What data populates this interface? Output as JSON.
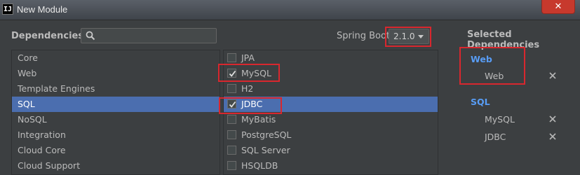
{
  "window": {
    "icon_text": "IJ",
    "title": "New Module",
    "close_glyph": "✕"
  },
  "header": {
    "dependencies_label": "Dependencies",
    "search": {
      "value": "",
      "placeholder": ""
    },
    "spring_boot_label": "Spring Boot",
    "spring_boot_version": "2.1.0",
    "selected_label": "Selected Dependencies"
  },
  "categories": [
    "Core",
    "Web",
    "Template Engines",
    "SQL",
    "NoSQL",
    "Integration",
    "Cloud Core",
    "Cloud Support"
  ],
  "selected_category": "SQL",
  "dependencies": [
    {
      "label": "JPA",
      "checked": false
    },
    {
      "label": "MySQL",
      "checked": true
    },
    {
      "label": "H2",
      "checked": false
    },
    {
      "label": "JDBC",
      "checked": true,
      "selected": true
    },
    {
      "label": "MyBatis",
      "checked": false
    },
    {
      "label": "PostgreSQL",
      "checked": false
    },
    {
      "label": "SQL Server",
      "checked": false
    },
    {
      "label": "HSQLDB",
      "checked": false
    }
  ],
  "selected_dependencies": [
    {
      "group": "Web",
      "items": [
        "Web"
      ]
    },
    {
      "group": "SQL",
      "items": [
        "MySQL",
        "JDBC"
      ]
    }
  ],
  "colors": {
    "accent": "#589df6",
    "selection": "#4b6eaf",
    "annotation": "#d9272e"
  }
}
